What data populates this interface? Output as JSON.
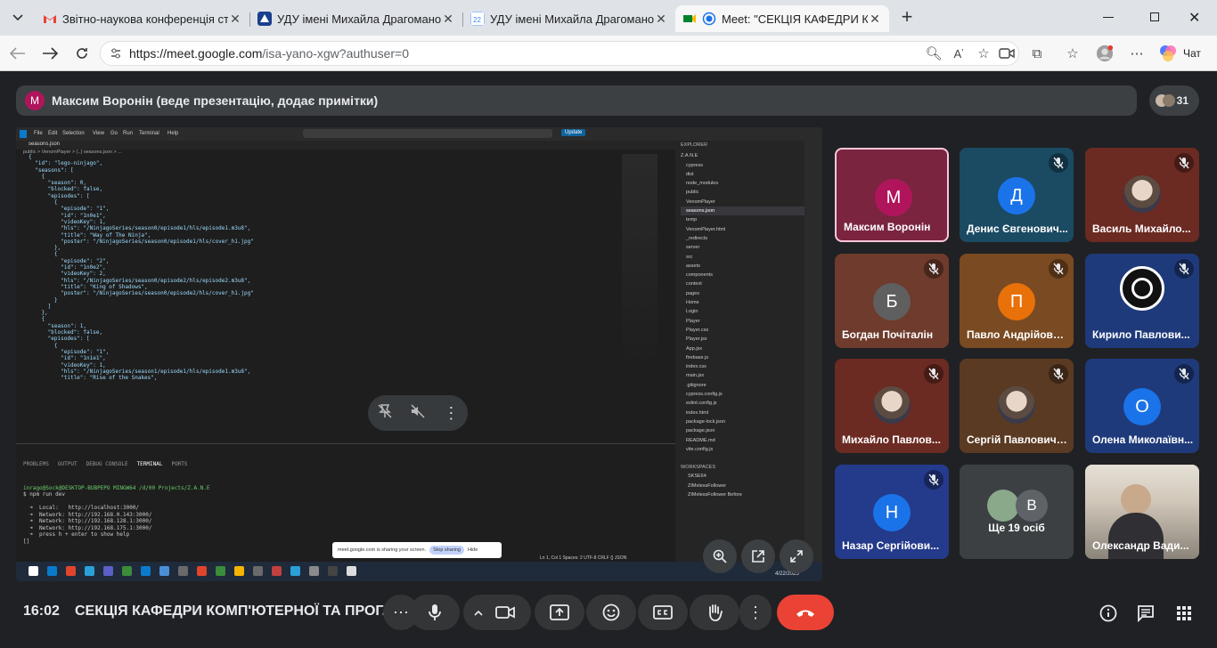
{
  "browser": {
    "tabs": [
      {
        "title": "Звітно-наукова конференція стар",
        "active": false
      },
      {
        "title": "УДУ імені Михайла Драгоманова",
        "active": false
      },
      {
        "title": "УДУ імені Михайла Драгоманова",
        "active": false
      },
      {
        "title": "Meet: \"СЕКЦІЯ КАФЕДРИ КОМ",
        "active": true
      }
    ],
    "url_host": "https://meet.google.com",
    "url_path": "/isa-yano-xgw?authuser=0",
    "chat_label": "Чат",
    "new_tab_symbol": "+"
  },
  "meet": {
    "presenter_initial": "М",
    "presenter_text": "Максим Воронін (веде презентацію, додає примітки)",
    "participant_count": "31",
    "clock": "16:02",
    "meeting_title": "СЕКЦІЯ КАФЕДРИ КОМП'ЮТЕРНОЇ ТА ПРОГ...",
    "tiles": [
      {
        "name": "Максим Воронін",
        "initial": "М",
        "color": "#b0155c",
        "bg": "#7a2440",
        "muted": false,
        "highlight": true
      },
      {
        "name": "Денис Євгенович...",
        "initial": "Д",
        "color": "#1a73e8",
        "bg": "#1b4a63",
        "muted": true
      },
      {
        "name": "Василь Михайло...",
        "initial": "",
        "color": "#888",
        "bg": "#6b2a22",
        "muted": true,
        "photo": true
      },
      {
        "name": "Богдан Почіталін",
        "initial": "Б",
        "color": "#5f5f5f",
        "bg": "#6e3b2c",
        "muted": true
      },
      {
        "name": "Павло Андрійови...",
        "initial": "П",
        "color": "#e8710a",
        "bg": "#7a4a22",
        "muted": true
      },
      {
        "name": "Кирило Павлови...",
        "initial": "",
        "color": "#000",
        "bg": "#1e3a7a",
        "muted": true,
        "obs": true
      },
      {
        "name": "Михайло Павлов...",
        "initial": "",
        "color": "#888",
        "bg": "#6b2a22",
        "muted": true,
        "photo": true
      },
      {
        "name": "Сергій Павлович ...",
        "initial": "",
        "color": "#888",
        "bg": "#5a3a22",
        "muted": true,
        "photo": true
      },
      {
        "name": "Олена Миколаївн...",
        "initial": "О",
        "color": "#1a73e8",
        "bg": "#1e3a7a",
        "muted": true
      },
      {
        "name": "Назар Сергійови...",
        "initial": "Н",
        "color": "#1a73e8",
        "bg": "#243a8a",
        "muted": true
      },
      {
        "name": "Ще 19 осіб",
        "initial": "В",
        "color": "#3c4043",
        "bg": "#3c4043",
        "muted": false,
        "more": true
      },
      {
        "name": "Олександр Вади...",
        "initial": "",
        "color": "#888",
        "bg": "#b8aa96",
        "muted": false,
        "room": true
      }
    ]
  },
  "screen": {
    "vscode_menu": [
      "File",
      "Edit",
      "Selection",
      "View",
      "Go",
      "Run",
      "Terminal",
      "Help"
    ],
    "update_label": "Update",
    "file_tab": "seasons.json",
    "breadcrumb": "public > VenomPlayer > {..} seasons.json > ...",
    "code_lines": [
      "{",
      "  \"id\": \"lego-ninjago\",",
      "  \"seasons\": [",
      "    {",
      "      \"season\": 0,",
      "      \"blocked\": false,",
      "      \"episodes\": [",
      "        {",
      "          \"episode\": \"1\",",
      "          \"id\": \"1n0e1\",",
      "          \"videoKey\": 1,",
      "          \"hls\": \"/NinjagoSeries/season0/episode1/hls/episode1.m3u8\",",
      "          \"title\": \"Way of The Ninja\",",
      "          \"poster\": \"/NinjagoSeries/season0/episode1/hls/cover_h1.jpg\"",
      "        },",
      "        {",
      "          \"episode\": \"2\",",
      "          \"id\": \"1n0e2\",",
      "          \"videoKey\": 2,",
      "          \"hls\": \"/NinjagoSeries/season0/episode2/hls/episode2.m3u8\",",
      "          \"title\": \"King of Shadows\",",
      "          \"poster\": \"/NinjagoSeries/season0/episode2/hls/cover_h1.jpg\"",
      "        }",
      "      ]",
      "    },",
      "    {",
      "      \"season\": 1,",
      "      \"blocked\": false,",
      "      \"episodes\": [",
      "        {",
      "          \"episode\": \"1\",",
      "          \"id\": \"1n1e1\",",
      "          \"videoKey\": 1,",
      "          \"hls\": \"/NinjagoSeries/season1/episode1/hls/episode1.m3u8\",",
      "          \"title\": \"Rise of the Snakes\","
    ],
    "explorer_title": "EXPLORER",
    "explorer_items": [
      "Z.A.N.E",
      "cypress",
      "dist",
      "node_modules",
      "public",
      "VenomPlayer",
      "seasons.json",
      "temp",
      "VenomPlayer.html",
      "_redirects",
      "server",
      "src",
      "assets",
      "components",
      "context",
      "pages",
      "Home",
      "Login",
      "Player",
      "Player.css",
      "Player.jsx",
      "App.jsx",
      "firebase.js",
      "index.css",
      "main.jsx",
      ".gitignore",
      "cypress.config.js",
      "eslint.config.js",
      "index.html",
      "package-lock.json",
      "package.json",
      "README.md",
      "vite.config.js"
    ],
    "terminal_tabs": [
      "PROBLEMS",
      "OUTPUT",
      "DEBUG CONSOLE",
      "TERMINAL",
      "PORTS"
    ],
    "terminal_lines": [
      "inrago@Sock@DESKTOP-BUBPEPO MINGW64 /d/00 Projects/Z.A.N.E",
      "$ npm run dev",
      "",
      "  ➜  Local:   http://localhost:3000/",
      "  ➜  Network: http://192.168.0.143:3000/",
      "  ➜  Network: http://192.168.128.1:3000/",
      "  ➜  Network: http://192.168.175.1:3000/",
      "  ➜  press h + enter to show help",
      "[]"
    ],
    "workspaces_title": "WORKSPACES",
    "workspaces": [
      "SKSE64",
      "ZIMelessFollower",
      "ZIMelessFollower Before"
    ],
    "share_notice": "meet.google.com is sharing your screen.",
    "stop_sharing": "Stop sharing",
    "hide": "Hide",
    "status_text": "Ln 1, Col 1   Spaces: 2   UTF-8   CRLF   {} JSON",
    "date_text": "4/22/2025"
  }
}
